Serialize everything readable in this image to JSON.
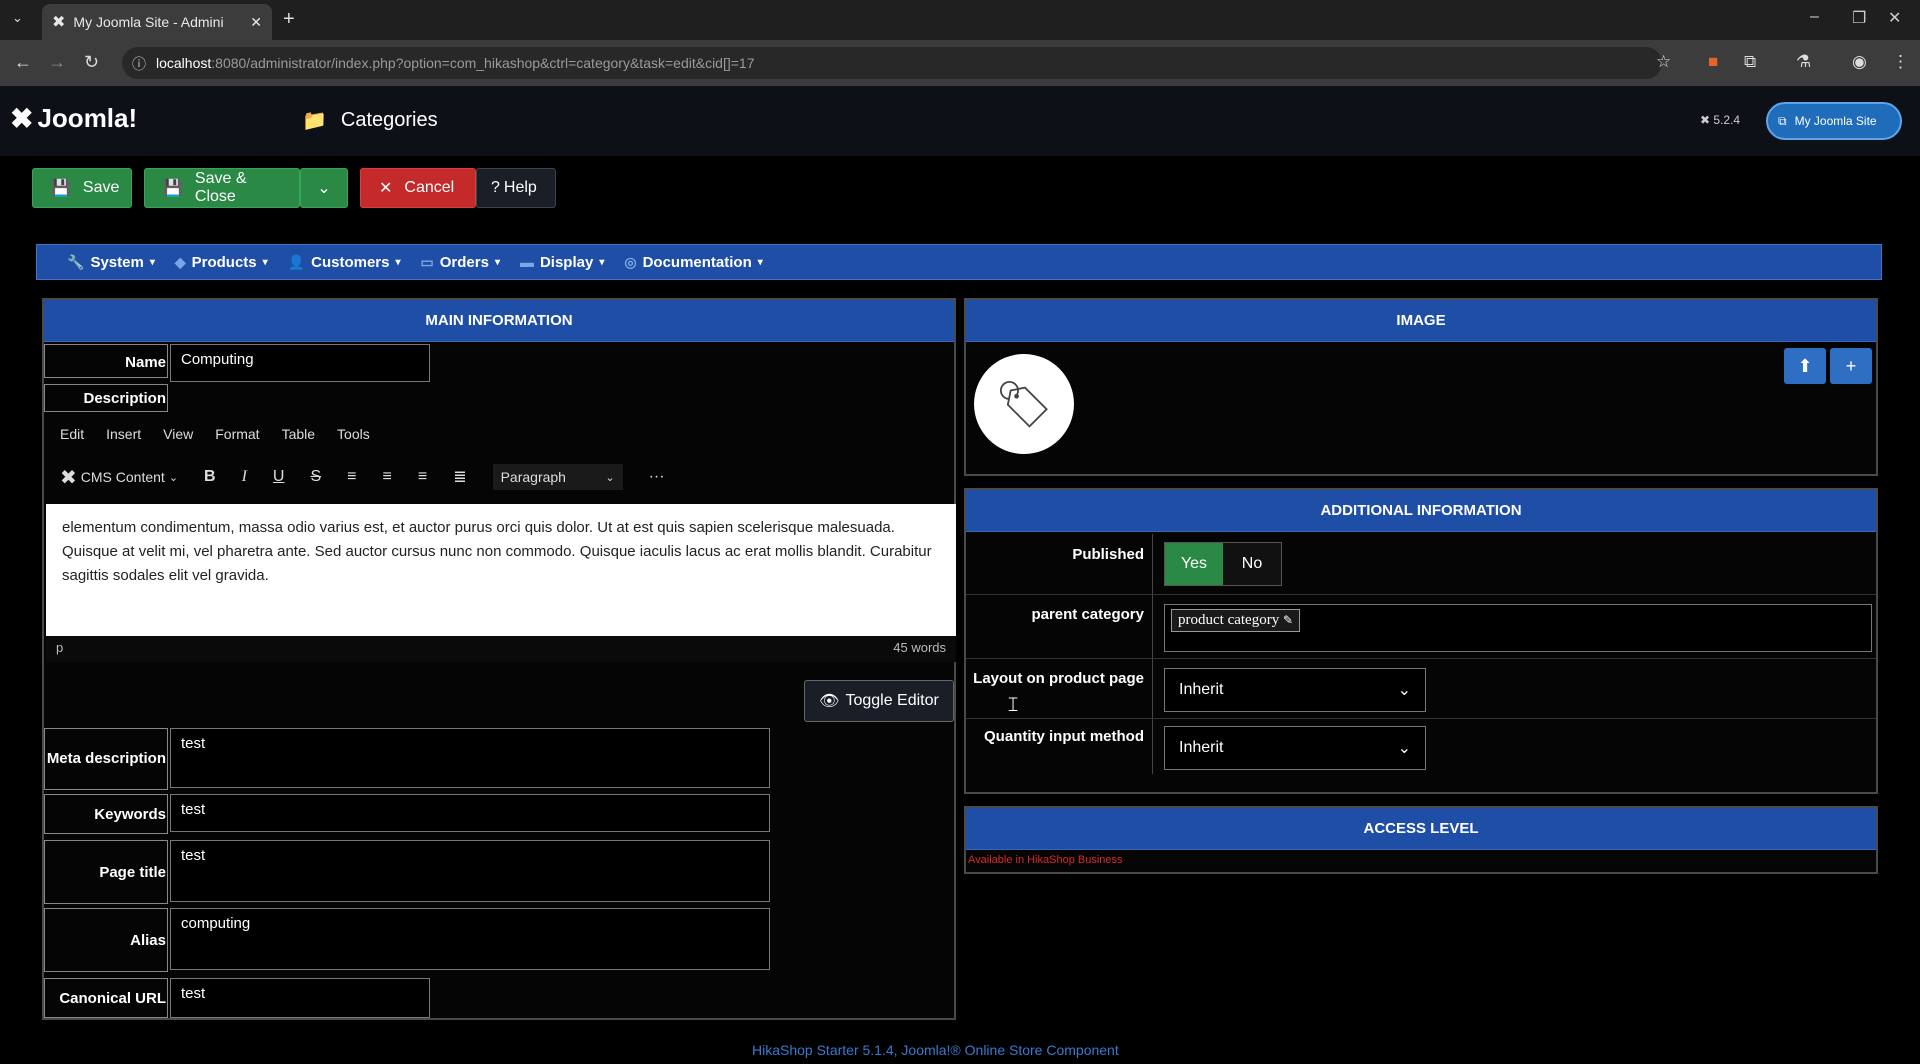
{
  "browser": {
    "tab_title": "My Joomla Site - Admini",
    "url_host": "localhost",
    "url_rest": ":8080/administrator/index.php?option=com_hikashop&ctrl=category&task=edit&cid[]=17"
  },
  "header": {
    "logo_text": "Joomla!",
    "page_title": "Categories",
    "version": "5.2.4",
    "site_button": "My Joomla Site"
  },
  "toolbar": {
    "save": "Save",
    "save_close": "Save & Close",
    "cancel": "Cancel",
    "help": "Help"
  },
  "menu": {
    "items": [
      "System",
      "Products",
      "Customers",
      "Orders",
      "Display",
      "Documentation"
    ]
  },
  "main": {
    "title": "MAIN INFORMATION",
    "name_label": "Name",
    "name_value": "Computing",
    "description_label": "Description",
    "editor_menu": [
      "Edit",
      "Insert",
      "View",
      "Format",
      "Table",
      "Tools"
    ],
    "cms_content": "CMS Content",
    "paragraph": "Paragraph",
    "editor_text": "elementum condimentum, massa odio varius est, et auctor purus orci quis dolor. Ut at est quis sapien scelerisque malesuada. Quisque at velit mi, vel pharetra ante. Sed auctor cursus nunc non commodo. Quisque iaculis lacus ac erat mollis blandit. Curabitur sagittis sodales elit vel gravida.",
    "editor_path": "p",
    "word_count": "45 words",
    "toggle_editor": "Toggle Editor",
    "meta_description_label": "Meta description",
    "meta_description_value": "test",
    "keywords_label": "Keywords",
    "keywords_value": "test",
    "page_title_label": "Page title",
    "page_title_value": "test",
    "alias_label": "Alias",
    "alias_value": "computing",
    "canonical_label": "Canonical URL",
    "canonical_value": "test"
  },
  "image": {
    "title": "IMAGE"
  },
  "additional": {
    "title": "ADDITIONAL INFORMATION",
    "published_label": "Published",
    "yes": "Yes",
    "no": "No",
    "parent_label": "parent category",
    "parent_value": "product category",
    "layout_label": "Layout on product page",
    "layout_value": "Inherit",
    "qty_label": "Quantity input method",
    "qty_value": "Inherit"
  },
  "access": {
    "title": "ACCESS LEVEL",
    "note": "Available in HikaShop Business"
  },
  "footer": {
    "text": "HikaShop Starter 5.1.4, Joomla!® Online Store Component"
  }
}
